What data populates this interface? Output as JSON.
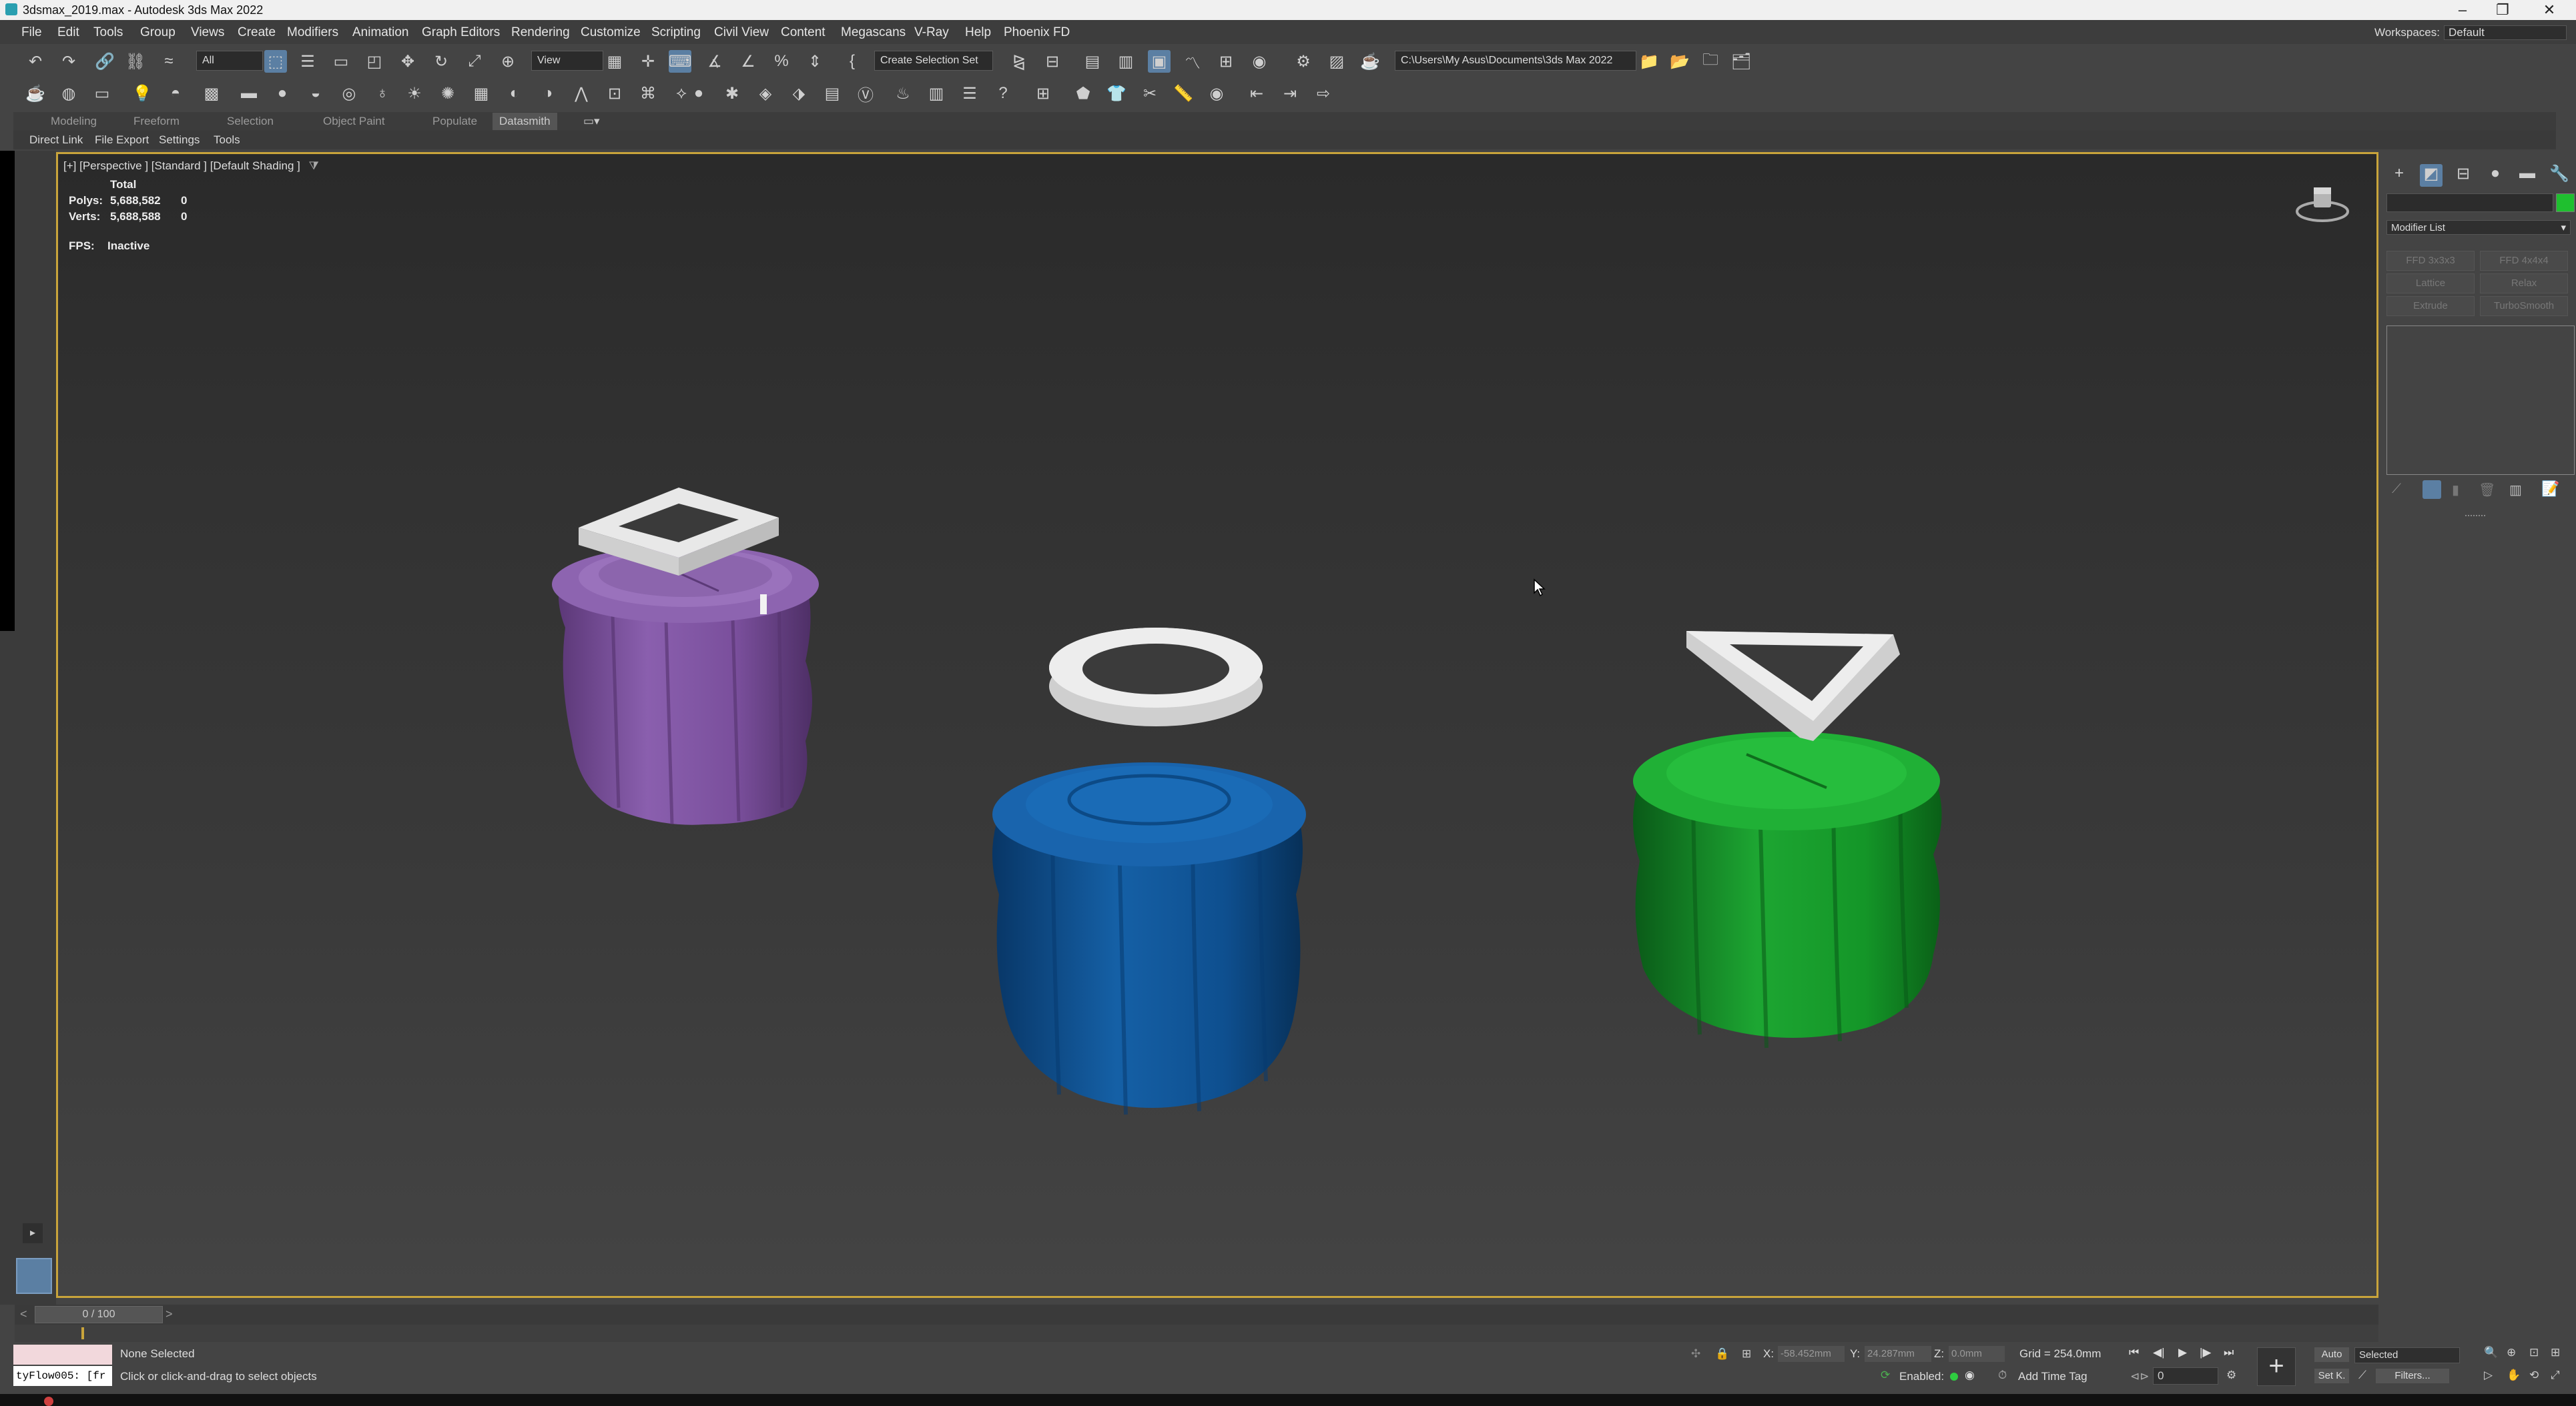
{
  "window": {
    "title": "3dsmax_2019.max - Autodesk 3ds Max 2022"
  },
  "menus": [
    "File",
    "Edit",
    "Tools",
    "Group",
    "Views",
    "Create",
    "Modifiers",
    "Animation",
    "Graph Editors",
    "Rendering",
    "Customize",
    "Scripting",
    "Civil View",
    "Content",
    "Megascans",
    "V-Ray",
    "Help",
    "Phoenix FD"
  ],
  "workspace": {
    "label": "Workspaces:",
    "value": "Default"
  },
  "toolbar": {
    "filter": "All",
    "coord_system": "View",
    "selection_set": "Create Selection Set",
    "project_path": "C:\\Users\\My Asus\\Documents\\3ds Max 2022"
  },
  "ribbon_tabs": [
    "Modeling",
    "Freeform",
    "Selection",
    "Object Paint",
    "Populate",
    "Datasmith"
  ],
  "ribbon_active": "Datasmith",
  "sub_tabs": [
    "Direct Link",
    "File Export",
    "Settings",
    "Tools"
  ],
  "viewport": {
    "label": "[+] [Perspective ] [Standard ] [Default Shading ]",
    "stats": {
      "total_label": "Total",
      "polys_label": "Polys:",
      "polys_total": "5,688,582",
      "polys_sel": "0",
      "verts_label": "Verts:",
      "verts_total": "5,688,588",
      "verts_sel": "0"
    },
    "fps_label": "FPS:",
    "fps_value": "Inactive",
    "objects": [
      {
        "name": "purple-knob",
        "color": "#7b4f9a"
      },
      {
        "name": "blue-knob",
        "color": "#0f4f8c"
      },
      {
        "name": "green-knob",
        "color": "#16962a"
      }
    ]
  },
  "command_panel": {
    "modifier_list": "Modifier List",
    "modifier_buttons": [
      "FFD 3x3x3",
      "FFD 4x4x4",
      "Lattice",
      "Relax",
      "Extrude",
      "TurboSmooth"
    ],
    "swatch_color": "#1fbf2f"
  },
  "timeline": {
    "frame": "0 / 100"
  },
  "status": {
    "script_listener": "tyFlow005: [fr",
    "selection": "None Selected",
    "prompt": "Click or click-and-drag to select objects",
    "x_label": "X:",
    "x_value": "-58.452mm",
    "y_label": "Y:",
    "y_value": "24.287mm",
    "z_label": "Z:",
    "z_value": "0.0mm",
    "grid": "Grid = 254.0mm",
    "enabled_label": "Enabled:",
    "add_time_tag": "Add Time Tag",
    "auto": "Auto",
    "set_key": "Set K.",
    "key_filter": "Selected",
    "filters": "Filters...",
    "frame_field": "0"
  }
}
